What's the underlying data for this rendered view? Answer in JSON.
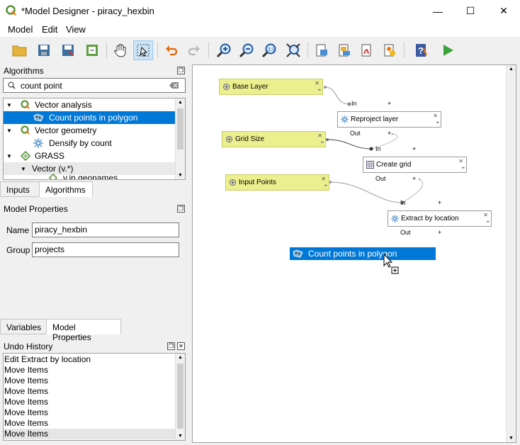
{
  "window": {
    "title": "*Model Designer - piracy_hexbin",
    "minimize": "—",
    "maximize": "☐",
    "close": "✕"
  },
  "menu": {
    "model": "Model",
    "edit": "Edit",
    "view": "View"
  },
  "algorithms_panel": {
    "title": "Algorithms",
    "search_value": "count point",
    "tree": [
      {
        "label": "Vector analysis",
        "level": 0
      },
      {
        "label": "Count points in polygon",
        "level": 1,
        "selected": true
      },
      {
        "label": "Vector geometry",
        "level": 0
      },
      {
        "label": "Densify by count",
        "level": 1
      },
      {
        "label": "GRASS",
        "level": 0
      },
      {
        "label": "Vector (v.*)",
        "level": 1
      },
      {
        "label": "v.in.geonames",
        "level": 2
      }
    ],
    "tabs": [
      "Inputs",
      "Algorithms"
    ]
  },
  "model_properties": {
    "title": "Model Properties",
    "name_label": "Name",
    "name_value": "piracy_hexbin",
    "group_label": "Group",
    "group_value": "projects",
    "tabs": [
      "Variables",
      "Model Properties"
    ]
  },
  "undo_history": {
    "title": "Undo History",
    "items": [
      "Edit Extract by location",
      "Move Items",
      "Move Items",
      "Move Items",
      "Move Items",
      "Move Items",
      "Move Items",
      "Move Items"
    ]
  },
  "canvas": {
    "inputs": [
      {
        "label": "Base Layer"
      },
      {
        "label": "Grid Size"
      },
      {
        "label": "Input Points"
      }
    ],
    "algorithms": [
      {
        "label": "Reproject layer",
        "in": "In",
        "out": "Out"
      },
      {
        "label": "Create grid",
        "in": "In",
        "out": "Out"
      },
      {
        "label": "Extract by location",
        "in": "In",
        "out": "Out"
      }
    ],
    "base_in_label": "In",
    "drag_label": "Count points in polygon"
  },
  "colors": {
    "accent": "#0078d7",
    "param_fill": "#ebef8e"
  }
}
